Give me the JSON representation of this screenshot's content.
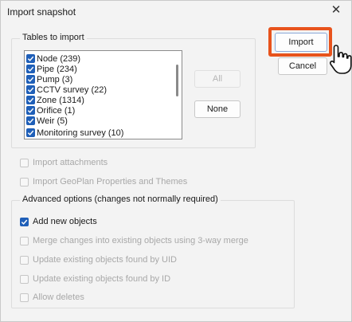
{
  "window": {
    "title": "Import snapshot",
    "close_glyph": "✕"
  },
  "tables_group": {
    "label": "Tables to import",
    "items": [
      {
        "label": "Node (239)",
        "checked": true
      },
      {
        "label": "Pipe (234)",
        "checked": true
      },
      {
        "label": "Pump (3)",
        "checked": true
      },
      {
        "label": "CCTV survey (22)",
        "checked": true
      },
      {
        "label": "Zone (1314)",
        "checked": true
      },
      {
        "label": "Orifice (1)",
        "checked": true
      },
      {
        "label": "Weir (5)",
        "checked": true
      },
      {
        "label": "Monitoring survey (10)",
        "checked": true
      }
    ],
    "all_label": "All",
    "none_label": "None"
  },
  "buttons": {
    "import_label": "Import",
    "cancel_label": "Cancel"
  },
  "options": {
    "import_attachments": "Import attachments",
    "import_geoplan": "Import GeoPlan Properties and Themes"
  },
  "advanced": {
    "label": "Advanced options  (changes not normally required)",
    "items": [
      {
        "label": "Add new objects",
        "checked": true,
        "enabled": true
      },
      {
        "label": "Merge changes into existing objects using 3-way merge",
        "checked": false,
        "enabled": false
      },
      {
        "label": "Update existing objects found by UID",
        "checked": false,
        "enabled": false
      },
      {
        "label": "Update existing objects found by ID",
        "checked": false,
        "enabled": false
      },
      {
        "label": "Allow deletes",
        "checked": false,
        "enabled": false
      }
    ]
  },
  "colors": {
    "highlight": "#e8531c",
    "checkbox_accent": "#1f5fb8"
  }
}
